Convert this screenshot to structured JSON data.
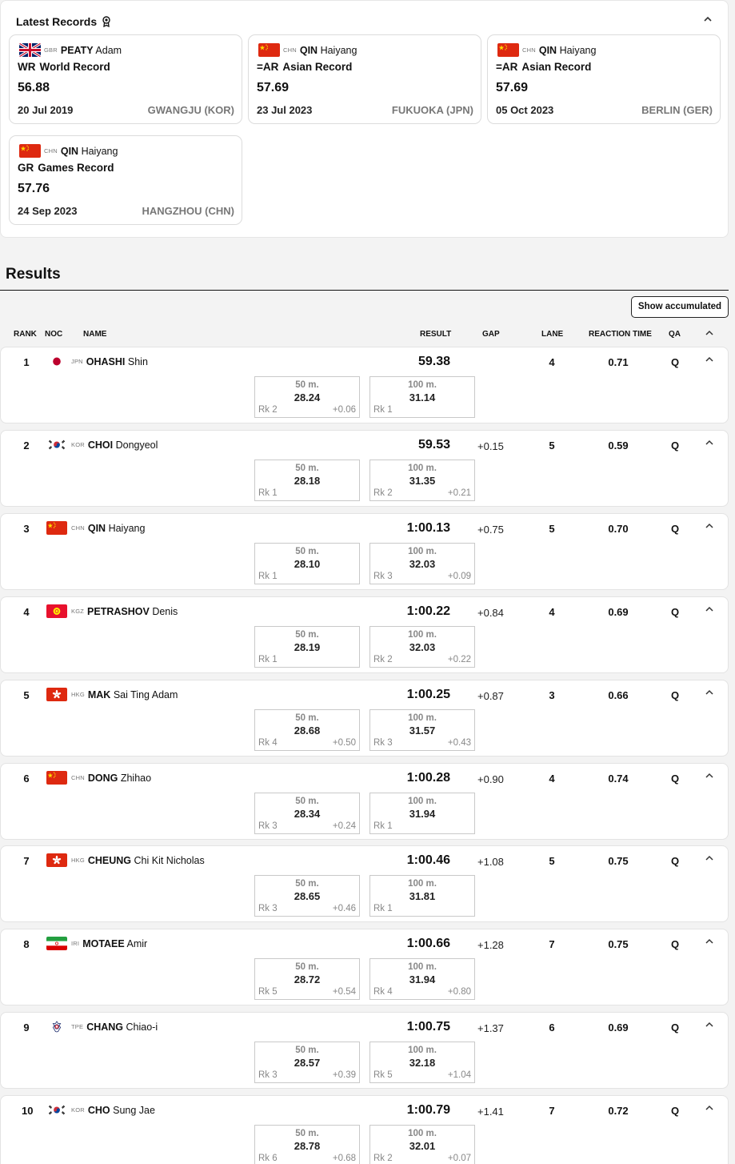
{
  "latest_records": {
    "title": "Latest Records",
    "cards": [
      {
        "noc": "GBR",
        "last": "PEATY",
        "first": "Adam",
        "code": "WR",
        "type": "World Record",
        "value": "56.88",
        "date": "20 Jul 2019",
        "place": "GWANGJU (KOR)"
      },
      {
        "noc": "CHN",
        "last": "QIN",
        "first": "Haiyang",
        "code": "=AR",
        "type": "Asian Record",
        "value": "57.69",
        "date": "23 Jul 2023",
        "place": "FUKUOKA (JPN)"
      },
      {
        "noc": "CHN",
        "last": "QIN",
        "first": "Haiyang",
        "code": "=AR",
        "type": "Asian Record",
        "value": "57.69",
        "date": "05 Oct 2023",
        "place": "BERLIN (GER)"
      },
      {
        "noc": "CHN",
        "last": "QIN",
        "first": "Haiyang",
        "code": "GR",
        "type": "Games Record",
        "value": "57.76",
        "date": "24 Sep 2023",
        "place": "HANGZHOU (CHN)"
      }
    ]
  },
  "results": {
    "title": "Results",
    "show_accumulated_label": "Show accumulated",
    "columns": {
      "rank": "RANK",
      "noc": "NOC",
      "name": "NAME",
      "result": "RESULT",
      "gap": "GAP",
      "lane": "LANE",
      "reaction_time": "REACTION TIME",
      "qa": "QA"
    },
    "split_labels": {
      "first": "50 m.",
      "second": "100 m."
    },
    "rows": [
      {
        "rank": "1",
        "noc": "JPN",
        "last": "OHASHI",
        "first": "Shin",
        "result": "59.38",
        "gap": "",
        "lane": "4",
        "reaction": "0.71",
        "qa": "Q",
        "s1": {
          "time": "28.24",
          "rk": "Rk 2",
          "gap": "+0.06"
        },
        "s2": {
          "time": "31.14",
          "rk": "Rk 1",
          "gap": ""
        }
      },
      {
        "rank": "2",
        "noc": "KOR",
        "last": "CHOI",
        "first": "Dongyeol",
        "result": "59.53",
        "gap": "+0.15",
        "lane": "5",
        "reaction": "0.59",
        "qa": "Q",
        "s1": {
          "time": "28.18",
          "rk": "Rk 1",
          "gap": ""
        },
        "s2": {
          "time": "31.35",
          "rk": "Rk 2",
          "gap": "+0.21"
        }
      },
      {
        "rank": "3",
        "noc": "CHN",
        "last": "QIN",
        "first": "Haiyang",
        "result": "1:00.13",
        "gap": "+0.75",
        "lane": "5",
        "reaction": "0.70",
        "qa": "Q",
        "s1": {
          "time": "28.10",
          "rk": "Rk 1",
          "gap": ""
        },
        "s2": {
          "time": "32.03",
          "rk": "Rk 3",
          "gap": "+0.09"
        }
      },
      {
        "rank": "4",
        "noc": "KGZ",
        "last": "PETRASHOV",
        "first": "Denis",
        "result": "1:00.22",
        "gap": "+0.84",
        "lane": "4",
        "reaction": "0.69",
        "qa": "Q",
        "s1": {
          "time": "28.19",
          "rk": "Rk 1",
          "gap": ""
        },
        "s2": {
          "time": "32.03",
          "rk": "Rk 2",
          "gap": "+0.22"
        }
      },
      {
        "rank": "5",
        "noc": "HKG",
        "last": "MAK",
        "first": "Sai Ting Adam",
        "result": "1:00.25",
        "gap": "+0.87",
        "lane": "3",
        "reaction": "0.66",
        "qa": "Q",
        "s1": {
          "time": "28.68",
          "rk": "Rk 4",
          "gap": "+0.50"
        },
        "s2": {
          "time": "31.57",
          "rk": "Rk 3",
          "gap": "+0.43"
        }
      },
      {
        "rank": "6",
        "noc": "CHN",
        "last": "DONG",
        "first": "Zhihao",
        "result": "1:00.28",
        "gap": "+0.90",
        "lane": "4",
        "reaction": "0.74",
        "qa": "Q",
        "s1": {
          "time": "28.34",
          "rk": "Rk 3",
          "gap": "+0.24"
        },
        "s2": {
          "time": "31.94",
          "rk": "Rk 1",
          "gap": ""
        }
      },
      {
        "rank": "7",
        "noc": "HKG",
        "last": "CHEUNG",
        "first": "Chi Kit Nicholas",
        "result": "1:00.46",
        "gap": "+1.08",
        "lane": "5",
        "reaction": "0.75",
        "qa": "Q",
        "s1": {
          "time": "28.65",
          "rk": "Rk 3",
          "gap": "+0.46"
        },
        "s2": {
          "time": "31.81",
          "rk": "Rk 1",
          "gap": ""
        }
      },
      {
        "rank": "8",
        "noc": "IRI",
        "last": "MOTAEE",
        "first": "Amir",
        "result": "1:00.66",
        "gap": "+1.28",
        "lane": "7",
        "reaction": "0.75",
        "qa": "Q",
        "s1": {
          "time": "28.72",
          "rk": "Rk 5",
          "gap": "+0.54"
        },
        "s2": {
          "time": "31.94",
          "rk": "Rk 4",
          "gap": "+0.80"
        }
      },
      {
        "rank": "9",
        "noc": "TPE",
        "last": "CHANG",
        "first": "Chiao-i",
        "result": "1:00.75",
        "gap": "+1.37",
        "lane": "6",
        "reaction": "0.69",
        "qa": "Q",
        "s1": {
          "time": "28.57",
          "rk": "Rk 3",
          "gap": "+0.39"
        },
        "s2": {
          "time": "32.18",
          "rk": "Rk 5",
          "gap": "+1.04"
        }
      },
      {
        "rank": "10",
        "noc": "KOR",
        "last": "CHO",
        "first": "Sung Jae",
        "result": "1:00.79",
        "gap": "+1.41",
        "lane": "7",
        "reaction": "0.72",
        "qa": "Q",
        "s1": {
          "time": "28.78",
          "rk": "Rk 6",
          "gap": "+0.68"
        },
        "s2": {
          "time": "32.01",
          "rk": "Rk 2",
          "gap": "+0.07"
        }
      }
    ]
  },
  "icons": {
    "medal": "medal-icon",
    "collapse": "chevron-up-icon",
    "flags": {
      "GBR": "flag-gbr-icon",
      "CHN": "flag-chn-icon",
      "JPN": "flag-jpn-icon",
      "KOR": "flag-kor-icon",
      "KGZ": "flag-kgz-icon",
      "HKG": "flag-hkg-icon",
      "IRI": "flag-iri-icon",
      "TPE": "flag-tpe-icon"
    }
  },
  "colors": {
    "red": "#de2910",
    "border": "#dcdcdc",
    "muted": "#777777"
  }
}
